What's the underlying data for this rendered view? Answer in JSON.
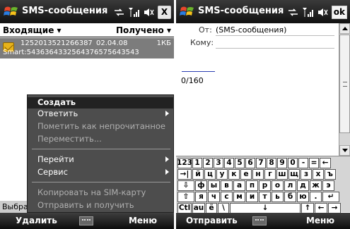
{
  "left": {
    "title": "SMS-сообщения",
    "close_label": "X",
    "folder": "Входящие ▾",
    "sort": "Получено ▾",
    "message": {
      "sender": "1252013521266387",
      "date": "02.04.08",
      "size": "1КБ",
      "preview": "Smart:5436364332564376575643543"
    },
    "partial_tab": "Выбра",
    "menu": [
      {
        "label": "Создать",
        "state": "selected"
      },
      {
        "label": "Ответить",
        "state": "enabled",
        "submenu": true
      },
      {
        "label": "Пометить как непрочитанное",
        "state": "disabled"
      },
      {
        "label": "Переместить...",
        "state": "disabled"
      },
      {
        "label": "Перейти",
        "state": "enabled",
        "submenu": true
      },
      {
        "label": "Сервис",
        "state": "enabled",
        "submenu": true
      },
      {
        "label": "Копировать на SIM-карту",
        "state": "disabled"
      },
      {
        "label": "Отправить и получить",
        "state": "disabled"
      }
    ],
    "softkeys": {
      "left": "Удалить",
      "right": "Меню"
    }
  },
  "right": {
    "title": "SMS-сообщения",
    "ok_label": "ok",
    "from_label": "От:",
    "from_value": "(SMS-сообщения)",
    "to_label": "Кому:",
    "counter": "0/160",
    "softkeys": {
      "left": "Отправить",
      "right": "Меню"
    },
    "keyboard": [
      [
        "123",
        "1",
        "2",
        "3",
        "4",
        "5",
        "6",
        "7",
        "8",
        "9",
        "0",
        "-",
        "=",
        "←"
      ],
      [
        "→|",
        "й",
        "ц",
        "у",
        "к",
        "е",
        "н",
        "г",
        "ш",
        "щ",
        "з",
        "х",
        "ъ"
      ],
      [
        "⇩",
        "ф",
        "ы",
        "в",
        "а",
        "п",
        "р",
        "о",
        "л",
        "д",
        "ж",
        "э"
      ],
      [
        "⇧",
        "я",
        "ч",
        "с",
        "м",
        "и",
        "т",
        "ь",
        "б",
        "ю",
        ".",
        "↵"
      ],
      [
        "Ctl",
        "au",
        "ё",
        "\\",
        "↓",
        "↑",
        "←",
        "→"
      ]
    ]
  },
  "colors": {
    "titlebar": "#1a1a1a",
    "selected_row": "#7c7c7c",
    "menu_bg": "#4d4d4d",
    "menu_sel": "#222222"
  }
}
